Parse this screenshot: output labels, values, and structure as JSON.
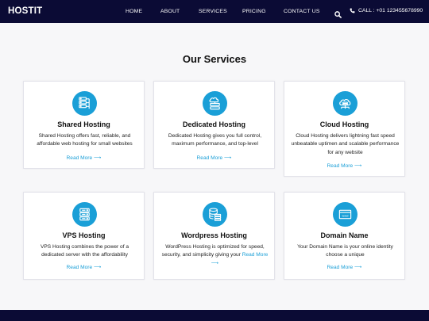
{
  "nav": {
    "brand": "HOSTIT",
    "links": [
      "HOME",
      "ABOUT",
      "SERVICES",
      "PRICING",
      "CONTACT US"
    ],
    "call_text": "CALL : +01 123455678990"
  },
  "services": {
    "title": "Our Services",
    "read_more": "Read More",
    "items": [
      {
        "title": "Shared Hosting",
        "text": "Shared Hosting offers fast, reliable, and affordable web hosting for small websites",
        "icon": "shared-hosting-icon"
      },
      {
        "title": "Dedicated Hosting",
        "text": "Dedicated Hosting gives you full control, maximum performance, and top-level",
        "icon": "dedicated-hosting-icon"
      },
      {
        "title": "Cloud Hosting",
        "text": "Cloud Hosting delivers lightning fast speed unbeatable uptimen and scalable performance for any website",
        "icon": "cloud-hosting-icon"
      },
      {
        "title": "VPS Hosting",
        "text": "VPS Hosting combines the power of a dedicated server with the affordability",
        "icon": "vps-hosting-icon"
      },
      {
        "title": "Wordpress Hosting",
        "text": "WordPress Hosting is optimized for speed, security, and simplicity giving your",
        "icon": "wordpress-hosting-icon"
      },
      {
        "title": "Domain Name",
        "text": "Your Domain Name is your online identity choose a unique",
        "icon": "domain-name-icon"
      }
    ]
  },
  "colors": {
    "navbar": "#0b0b35",
    "accent": "#1a9fd7",
    "background": "#f7f7f9"
  }
}
